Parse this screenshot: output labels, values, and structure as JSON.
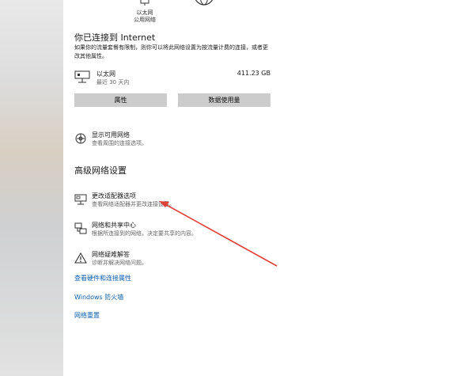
{
  "status": {
    "ethernet_caption_1": "以太网",
    "ethernet_caption_2": "公用网络"
  },
  "connected": {
    "title": "你已连接到 Internet",
    "description": "如果你的流量套餐有限制，则你可以将此网络设置为按流量计费的连接，或者更改其他属性。"
  },
  "ethernet": {
    "name": "以太网",
    "period": "最近 30 天内",
    "usage": "411.23 GB"
  },
  "buttons": {
    "properties": "属性",
    "data_usage": "数据使用量"
  },
  "show_networks": {
    "title": "显示可用网络",
    "subtitle": "查看周围的连接选项。"
  },
  "advanced": {
    "title": "高级网络设置",
    "items": [
      {
        "title": "更改适配器选项",
        "subtitle": "查看网络适配器并更改连接设置。"
      },
      {
        "title": "网络和共享中心",
        "subtitle": "根据所连接到的网络，决定要共享的内容。"
      },
      {
        "title": "网络疑难解答",
        "subtitle": "诊断并解决网络问题。"
      }
    ]
  },
  "links": {
    "hardware": "查看硬件和连接属性",
    "firewall": "Windows 防火墙",
    "reset": "网络重置"
  },
  "colors": {
    "link": "#0b5fae",
    "button_bg": "#cccccc",
    "annotation_arrow": "#e0403a"
  },
  "icons": [
    "ethernet-status-icon",
    "monitor-icon",
    "globe-icon",
    "network-scan-icon",
    "adapter-icon",
    "sharing-center-icon",
    "warning-icon"
  ]
}
